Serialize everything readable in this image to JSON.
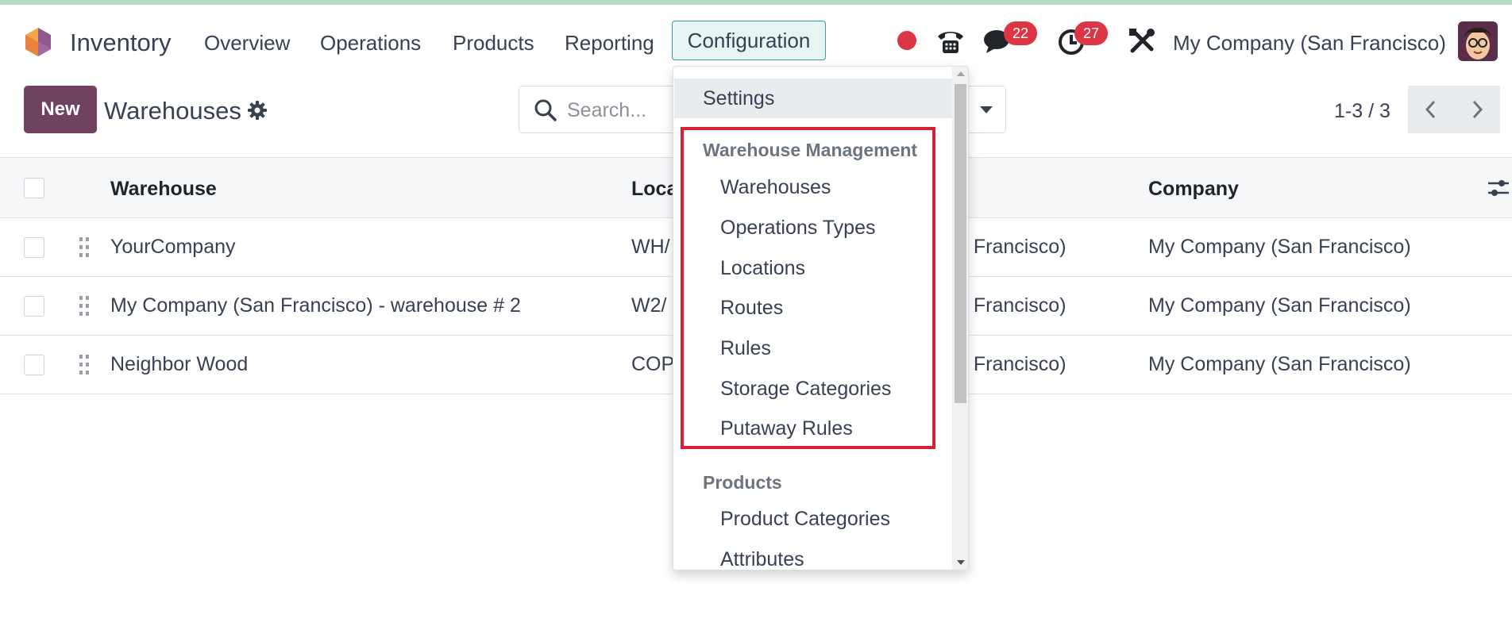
{
  "navbar": {
    "app_name": "Inventory",
    "menu": [
      "Overview",
      "Operations",
      "Products",
      "Reporting",
      "Configuration"
    ],
    "messages_badge": "22",
    "activities_badge": "27",
    "company": "My Company (San Francisco)"
  },
  "control_panel": {
    "new_label": "New",
    "title": "Warehouses",
    "search_placeholder": "Search...",
    "pager": "1-3 / 3"
  },
  "table": {
    "columns": [
      "Warehouse",
      "Loca",
      "Company"
    ],
    "rows": [
      {
        "warehouse": "YourCompany",
        "location": "WH/",
        "address_tail": "n Francisco)",
        "company": "My Company (San Francisco)"
      },
      {
        "warehouse": "My Company (San Francisco) - warehouse # 2",
        "location": "W2/",
        "address_tail": "n Francisco)",
        "company": "My Company (San Francisco)"
      },
      {
        "warehouse": "Neighbor Wood",
        "location": "COP",
        "address_tail": "n Francisco)",
        "company": "My Company (San Francisco)"
      }
    ]
  },
  "dropdown": {
    "settings": "Settings",
    "section1_header": "Warehouse Management",
    "section1_items": [
      "Warehouses",
      "Operations Types",
      "Locations",
      "Routes",
      "Rules",
      "Storage Categories",
      "Putaway Rules"
    ],
    "section2_header": "Products",
    "section2_items": [
      "Product Categories",
      "Attributes"
    ]
  },
  "colors": {
    "brand": "#71425f",
    "highlight": "#d62232",
    "badge": "#dc3545",
    "active_menu_border": "#3b9b9e"
  }
}
